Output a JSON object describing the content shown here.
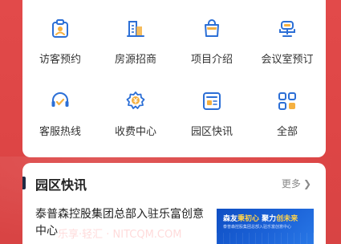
{
  "colors": {
    "background": "#e04848",
    "accent": "#2c6fd6",
    "icon_secondary": "#f5b040"
  },
  "quick_menu": [
    {
      "label": "访客预约",
      "icon": "visitor-badge-icon"
    },
    {
      "label": "房源招商",
      "icon": "building-icon"
    },
    {
      "label": "项目介绍",
      "icon": "shopping-bag-icon"
    },
    {
      "label": "会议室预订",
      "icon": "meeting-chair-icon"
    },
    {
      "label": "客服热线",
      "icon": "headset-icon"
    },
    {
      "label": "收费中心",
      "icon": "gear-yen-icon"
    },
    {
      "label": "园区快讯",
      "icon": "news-board-icon"
    },
    {
      "label": "全部",
      "icon": "grid-apps-icon"
    }
  ],
  "news": {
    "section_title": "园区快讯",
    "more_label": "更多",
    "articles": [
      {
        "title": "泰普森控股集团总部入驻乐富创意中心",
        "thumb_line1_a": "森友",
        "thumb_line1_b": "秉初心",
        "thumb_line1_c": "聚力",
        "thumb_line1_d": "创未来",
        "thumb_line2": "泰普森控股集团总部入驻乐富创意中心"
      }
    ]
  },
  "watermark": "乐享·轻汇 · NITCQM.COM"
}
